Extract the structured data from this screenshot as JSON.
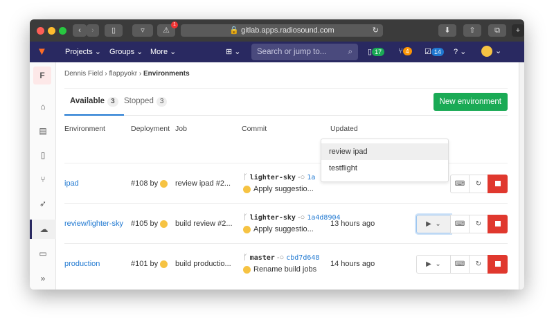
{
  "browser": {
    "url": "gitlab.apps.radiosound.com",
    "alert_count": "1"
  },
  "nav": {
    "projects": "Projects",
    "groups": "Groups",
    "more": "More",
    "search_placeholder": "Search or jump to...",
    "issues_count": "17",
    "mr_count": "4",
    "todo_count": "14",
    "colors": {
      "bg": "#292961",
      "issues": "#1aaa55",
      "mr": "#fc9403",
      "todo": "#1f78d1"
    }
  },
  "sidebar": {
    "project_letter": "F"
  },
  "breadcrumb": [
    "Dennis Field",
    "flappyokr",
    "Environments"
  ],
  "tabs": [
    {
      "label": "Available",
      "count": "3"
    },
    {
      "label": "Stopped",
      "count": "3"
    }
  ],
  "new_button": "New environment",
  "columns": [
    "Environment",
    "Deployment",
    "Job",
    "Commit",
    "Updated"
  ],
  "rows": [
    {
      "env": "ipad",
      "deploy": "#108 by",
      "job": "review ipad #2...",
      "branch": "lighter-sky",
      "sha": "1a",
      "message": "Apply suggestio...",
      "updated": ""
    },
    {
      "env": "review/lighter-sky",
      "deploy": "#105 by",
      "job": "build review #2...",
      "branch": "lighter-sky",
      "sha": "1a4d8904",
      "message": "Apply suggestio...",
      "updated": "13 hours ago"
    },
    {
      "env": "production",
      "deploy": "#101 by",
      "job": "build productio...",
      "branch": "master",
      "sha": "cbd7d648",
      "message": "Rename build jobs",
      "updated": "14 hours ago"
    }
  ],
  "dropdown": [
    "review ipad",
    "testflight"
  ]
}
